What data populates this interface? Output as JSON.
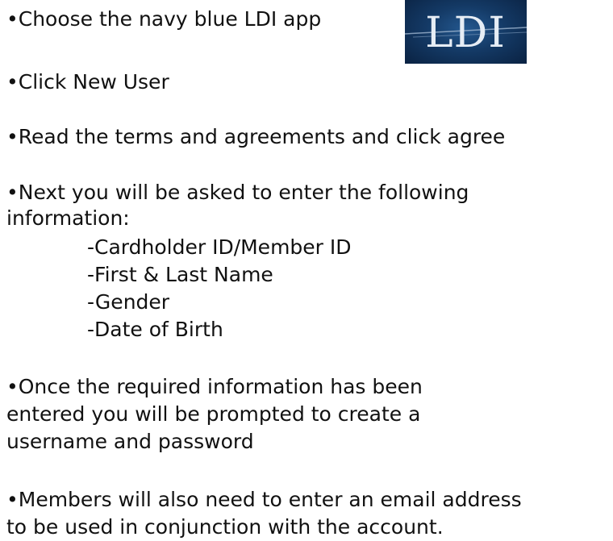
{
  "instructions": {
    "step1": "•Choose the navy blue LDI app",
    "step2": "•Click New User",
    "step3": "•Read the terms and agreements and click agree",
    "step4_line1": "•Next you will be asked to enter the following",
    "step4_line2": "information:",
    "fields": [
      "-Cardholder ID/Member ID",
      "-First & Last Name",
      "-Gender",
      "-Date of Birth"
    ],
    "step5_line1": "•Once the required information has been",
    "step5_line2": "entered you will be prompted to create a",
    "step5_line3": "username and password",
    "step6_line1": "•Members will also need to enter an email address",
    "step6_line2": "to be used in conjunction with the account."
  },
  "logo": {
    "text": "LDI",
    "background_color": "#143a66",
    "text_color": "#e6edf5"
  }
}
